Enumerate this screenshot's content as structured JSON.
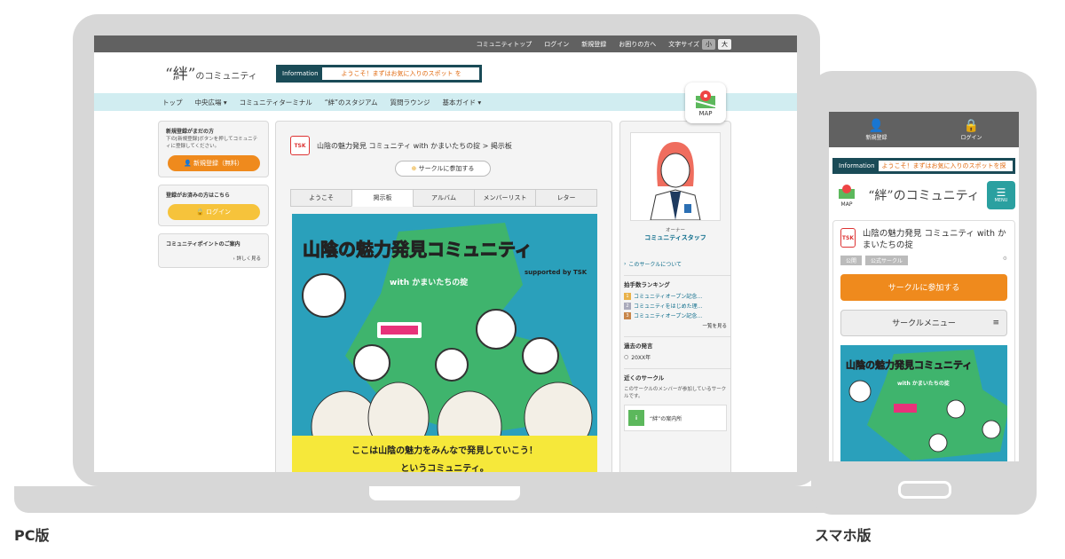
{
  "pc": {
    "topbar": [
      "コミュニティトップ",
      "ログイン",
      "新規登録",
      "お困りの方へ"
    ],
    "font_size": {
      "label": "文字サイズ",
      "small": "小",
      "large": "大"
    },
    "logo": {
      "main": "“絆”",
      "sub": "のコミュニティ"
    },
    "info": {
      "label": "Information",
      "text": "ようこそ！まずはお気に入りのスポット を"
    },
    "map": "MAP",
    "nav": [
      "トップ",
      "中央広場 ▾",
      "コミュニティターミナル",
      "“絆”のスタジアム",
      "質問ラウンジ",
      "基本ガイド ▾"
    ],
    "left": {
      "reg_title": "新規登録がまだの方",
      "reg_text": "下の[新規登録]ボタンを押してコミュニティに登録してください。",
      "reg_btn": "新規登録（無料）",
      "login_title": "登録がお済みの方はこちら",
      "login_btn": "ログイン",
      "points_title": "コミュニティポイントのご案内",
      "more": "詳しく見る"
    },
    "center": {
      "tsk": "TSK",
      "title": "山陰の魅力発見 コミュニティ with かまいたちの掟 > 掲示板",
      "join": "サークルに参加する",
      "tabs": [
        "ようこそ",
        "掲示板",
        "アルバム",
        "メンバーリスト",
        "レター"
      ],
      "banner_title": "山陰の魅力発見コミュニティ",
      "banner_with": "with かまいたちの掟",
      "banner_supported": "supported by TSK",
      "banner_text1": "ここは山陰の魅力をみんなで発見していこう！",
      "banner_text2": "というコミュニティ。"
    },
    "right": {
      "owner_label": "オーナー",
      "owner_name": "コミュニティスタッフ",
      "about": "このサークルについて",
      "rank_title": "拍手数ランキング",
      "rank": [
        "コミュニティオープン記念…",
        "コミュニティをはじめた理…",
        "コミュニティオープン記念…"
      ],
      "rank_more": "一覧を見る",
      "past_title": "過去の発言",
      "past": "20XX年",
      "near_title": "近くのサークル",
      "near_text": "このサークルのメンバーが参加しているサークルです。",
      "guide": "“絆”の案内所"
    }
  },
  "sp": {
    "register": "新規登録",
    "login": "ログイン",
    "info_label": "Information",
    "info_text": "ようこそ！まずはお気に入りのスポットを探",
    "map": "MAP",
    "logo": "“絆”のコミュニティ",
    "menu": "MENU",
    "title": "山陰の魅力発見 コミュニティ with かまいたちの掟",
    "tag1": "公開",
    "tag2": "公式サークル",
    "join": "サークルに参加する",
    "circle_menu": "サークルメニュー"
  },
  "captions": {
    "pc": "PC版",
    "sp": "スマホ版"
  },
  "colors": {
    "accent": "#ef8a1d",
    "nav": "#d1edf1",
    "topbar": "#616161",
    "banner": "#2aa0bb",
    "yellow": "#f6e83a"
  }
}
